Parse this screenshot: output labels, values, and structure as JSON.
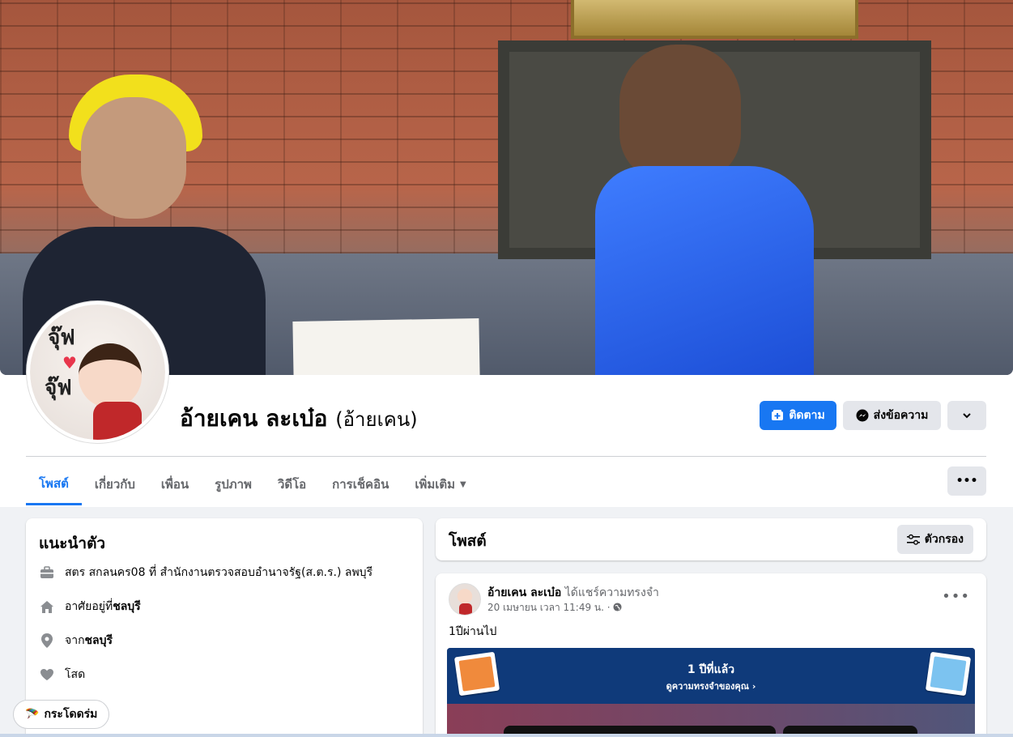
{
  "profile": {
    "name": "อ้ายเคน ละเบ๋อ",
    "alt_name": "(อ้ายเคน)",
    "avatar_text_top": "จุ๊ฟ",
    "avatar_text_bottom": "จุ๊ฟ"
  },
  "actions": {
    "follow": "ติดตาม",
    "message": "ส่งข้อความ"
  },
  "tabs": [
    {
      "label": "โพสต์"
    },
    {
      "label": "เกี่ยวกับ"
    },
    {
      "label": "เพื่อน"
    },
    {
      "label": "รูปภาพ"
    },
    {
      "label": "วิดีโอ"
    },
    {
      "label": "การเช็คอิน"
    },
    {
      "label": "เพิ่มเติม"
    }
  ],
  "intro": {
    "title": "แนะนำตัว",
    "work": "สตร สกลนคร08 ที่ สำนักงานตรวจสอบอำนาจรัฐ(ส.ต.ร.) ลพบุรี",
    "lives_prefix": "อาศัยอยู่ที่ ",
    "lives_place": "ชลบุรี",
    "from_prefix": "จาก ",
    "from_place": "ชลบุรี",
    "relationship": "โสด",
    "chip": "กระโดดร่ม"
  },
  "posts_header": {
    "title": "โพสต์",
    "filter": "ตัวกรอง"
  },
  "post": {
    "author": "อ้ายเคน ละเบ๋อ",
    "action": "ได้แชร์ความทรงจำ",
    "meta": "20 เมษายน เวลา 11:49 น. ·",
    "text": "1ปีผ่านไป",
    "memory_title": "1 ปีที่แล้ว",
    "memory_link": "ดูความทรงจำของคุณ"
  },
  "colors": {
    "accent": "#1877f2",
    "memory_band": "#0f3a7a"
  }
}
